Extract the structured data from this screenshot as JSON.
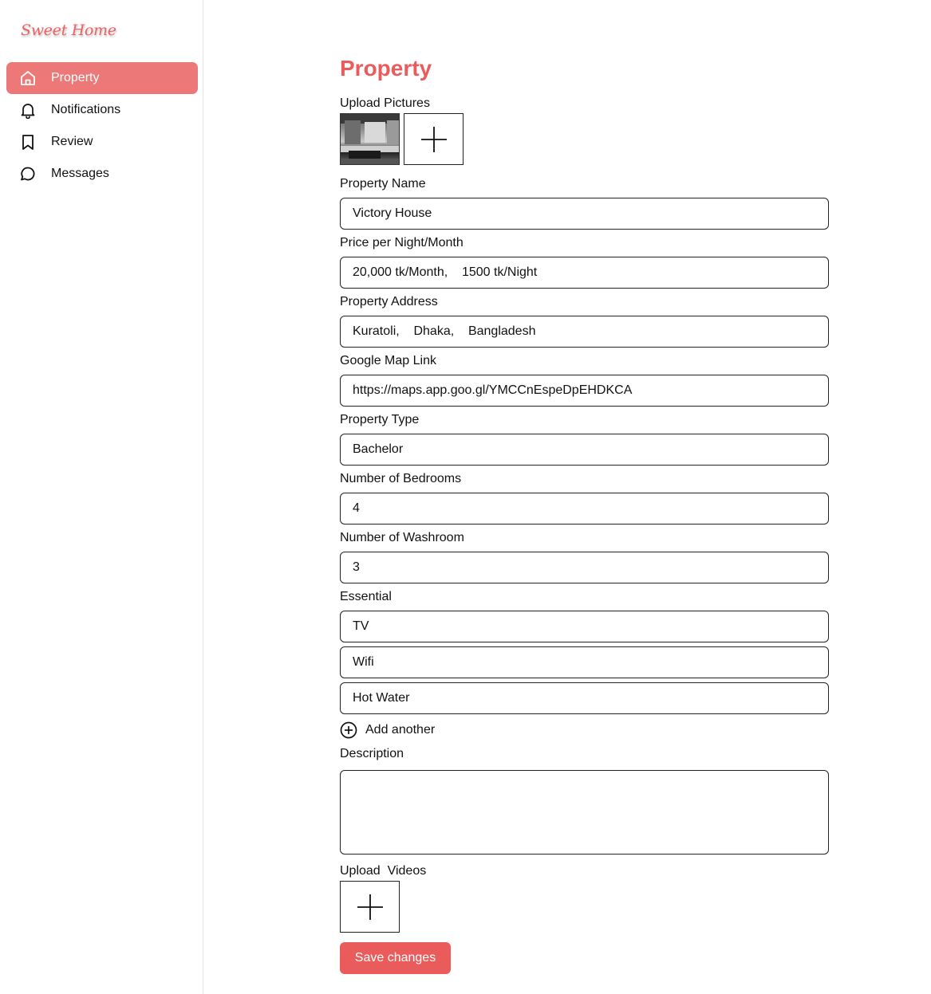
{
  "app": {
    "logo_text": "Sweet Home",
    "brand_color": "#ea5c5c"
  },
  "sidebar": {
    "items": [
      {
        "label": "Property",
        "icon": "home-icon",
        "active": true
      },
      {
        "label": "Notifications",
        "icon": "bell-icon",
        "active": false
      },
      {
        "label": "Review",
        "icon": "bookmark-icon",
        "active": false
      },
      {
        "label": "Messages",
        "icon": "chat-bubble-icon",
        "active": false
      }
    ]
  },
  "form": {
    "title": "Property",
    "upload_pictures_label": "Upload Pictures",
    "property_name_label": "Property Name",
    "property_name_value": "Victory House",
    "price_label": "Price per Night/Month",
    "price_value": "20,000 tk/Month,    1500 tk/Night",
    "address_label": "Property Address",
    "address_value": "Kuratoli,    Dhaka,    Bangladesh",
    "map_link_label": "Google Map Link",
    "map_link_value": "https://maps.app.goo.gl/YMCCnEspeDpEHDKCA",
    "type_label": "Property Type",
    "type_value": "Bachelor",
    "bedrooms_label": "Number of Bedrooms",
    "bedrooms_value": "4",
    "washroom_label": "Number of Washroom",
    "washroom_value": "3",
    "essential_label": "Essential",
    "essentials": [
      "TV",
      "Wifi",
      "Hot Water"
    ],
    "add_another_label": "Add another",
    "description_label": "Description",
    "description_value": "",
    "upload_videos_label": "Upload  Videos",
    "save_label": "Save changes"
  }
}
